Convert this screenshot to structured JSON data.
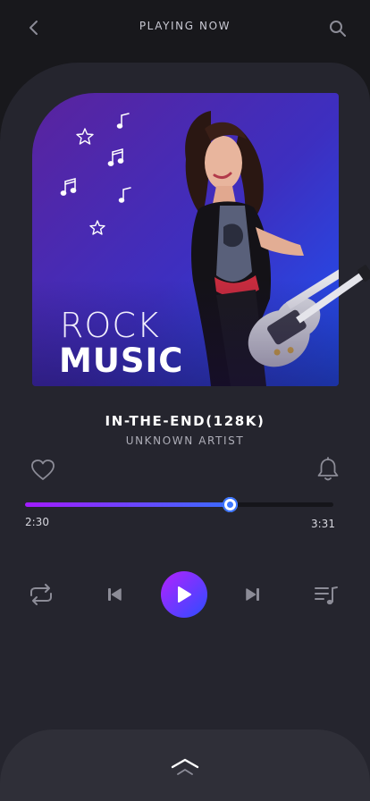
{
  "header": {
    "title": "PLAYING NOW",
    "back_icon": "chevron-left-icon",
    "search_icon": "search-icon"
  },
  "cover": {
    "line1": "ROCK",
    "line2": "MUSIC"
  },
  "track": {
    "title": "IN-THE-END(128K)",
    "artist": "UNKNOWN ARTIST"
  },
  "progress": {
    "current": "2:30",
    "total": "3:31",
    "fraction": 0.667
  },
  "controls": {
    "icons": [
      "repeat-icon",
      "skip-previous-icon",
      "play-icon",
      "skip-next-icon",
      "queue-music-icon"
    ]
  },
  "colors": {
    "accent_start": "#b421ff",
    "accent_end": "#2c4dff",
    "background": "#25252e"
  }
}
